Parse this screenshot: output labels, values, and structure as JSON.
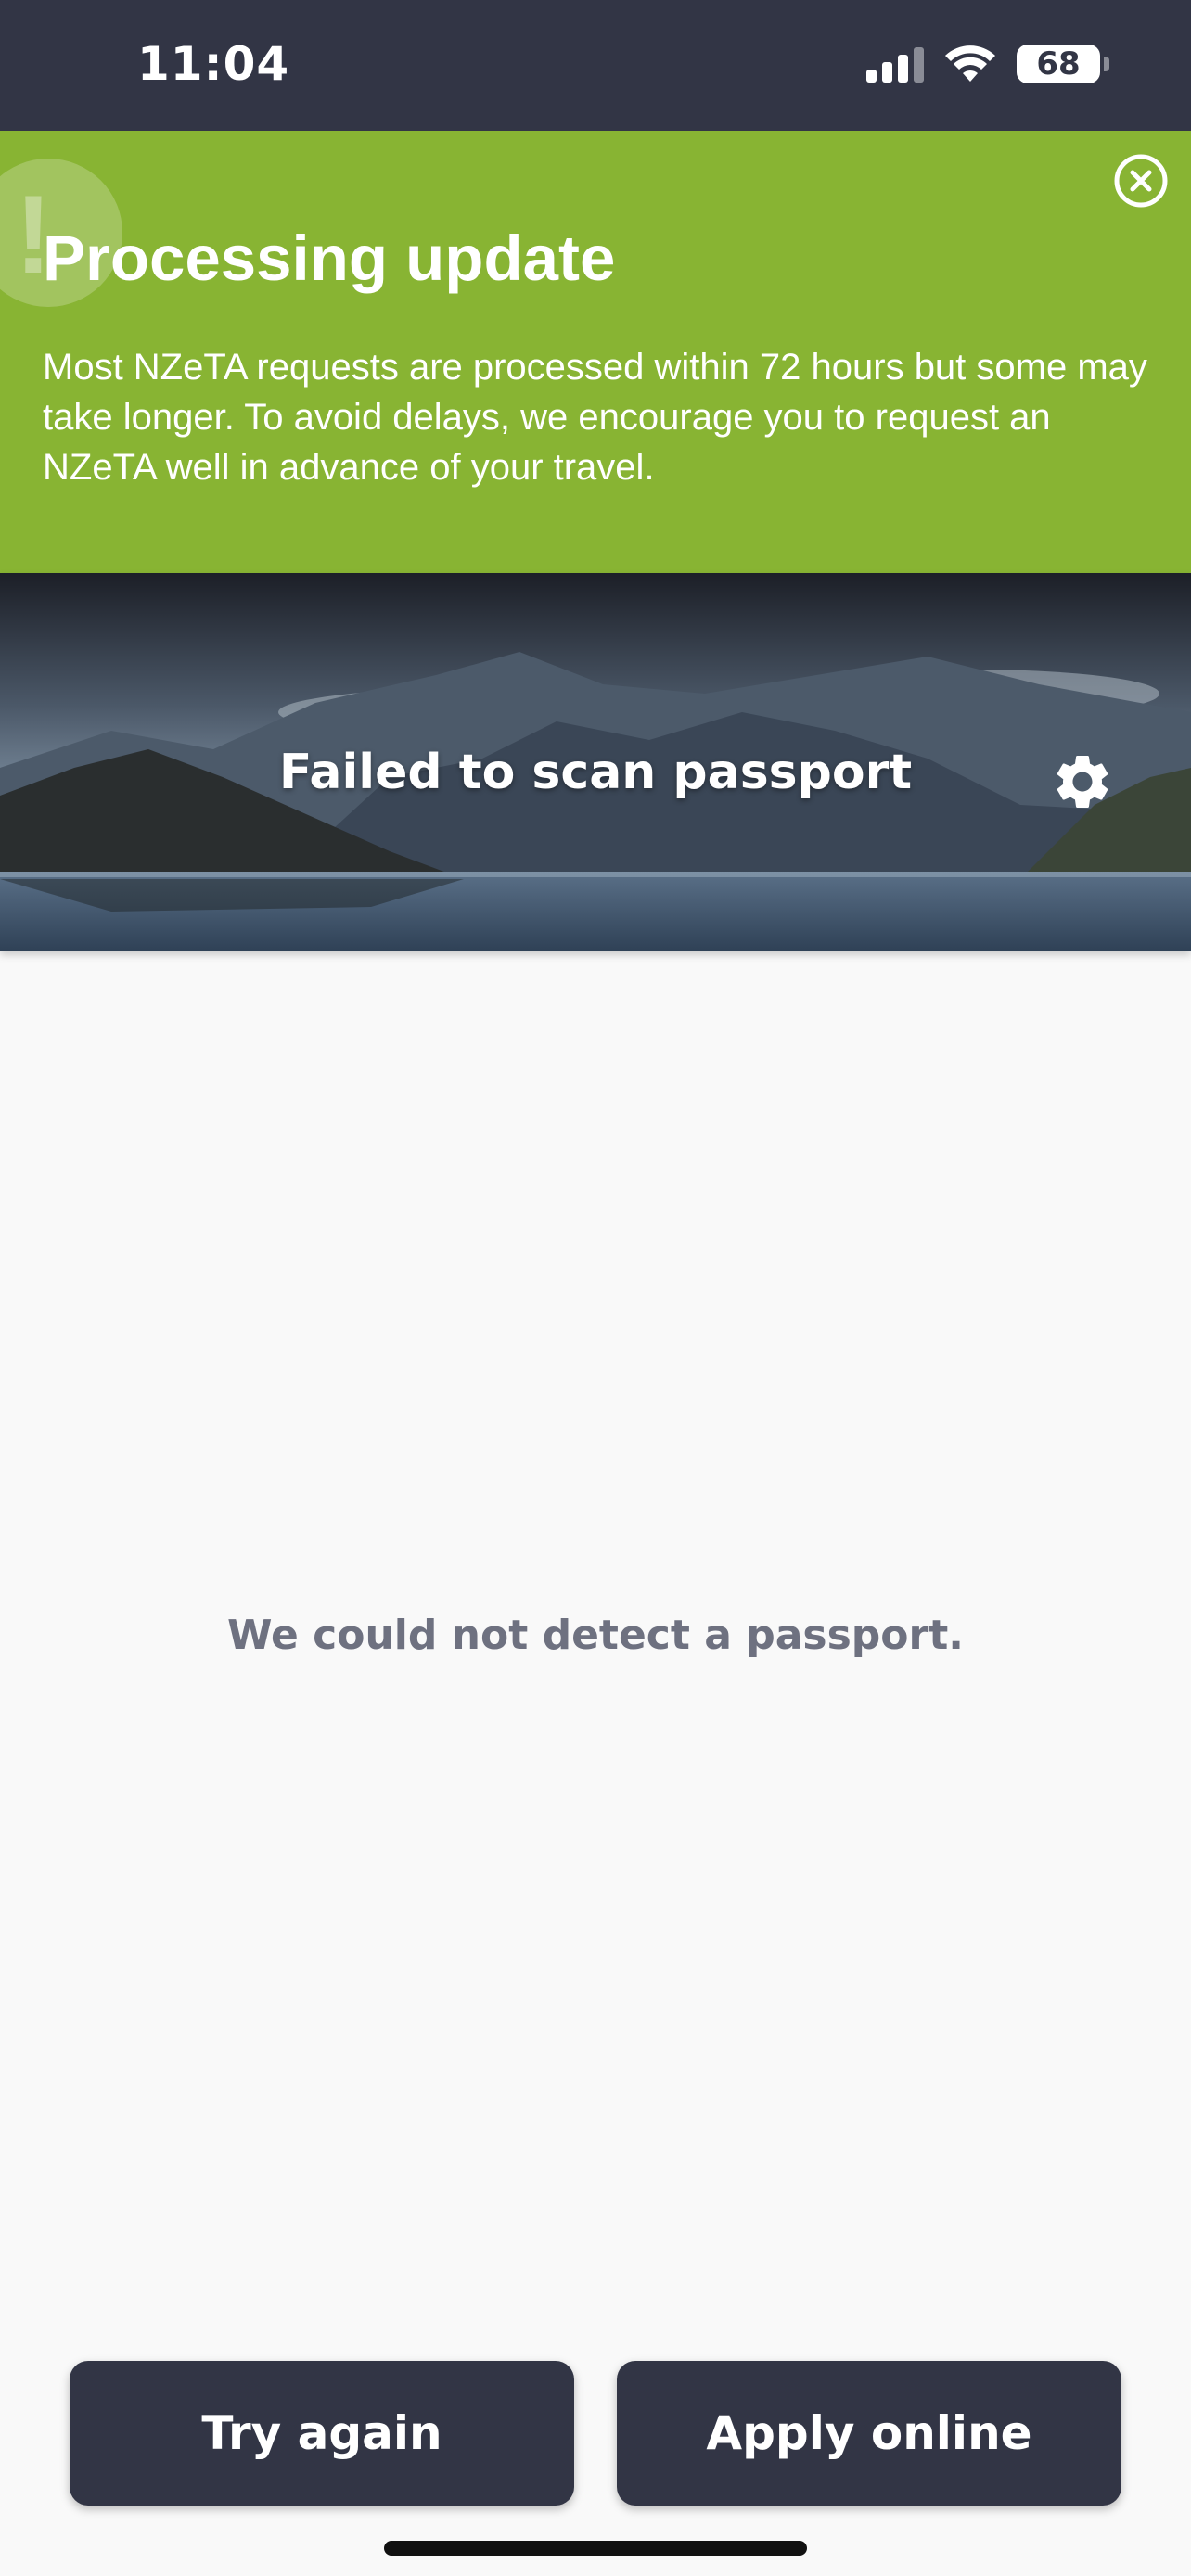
{
  "status_bar": {
    "time": "11:04",
    "battery": "68",
    "icons": [
      "signal-icon",
      "wifi-icon",
      "battery-icon"
    ]
  },
  "alert": {
    "title": "Processing update",
    "body": "Most NZeTA requests are processed within 72 hours but some may take longer. To avoid delays, we encourage you to request an NZeTA well in advance of your travel.",
    "background_color": "#88b433",
    "icons": [
      "exclamation-icon",
      "close-icon"
    ]
  },
  "header": {
    "title": "Failed to scan passport",
    "icons": [
      "gear-icon"
    ]
  },
  "main": {
    "message": "We could not detect a passport."
  },
  "actions": {
    "try_again_label": "Try again",
    "apply_online_label": "Apply online",
    "button_color": "#323545"
  }
}
